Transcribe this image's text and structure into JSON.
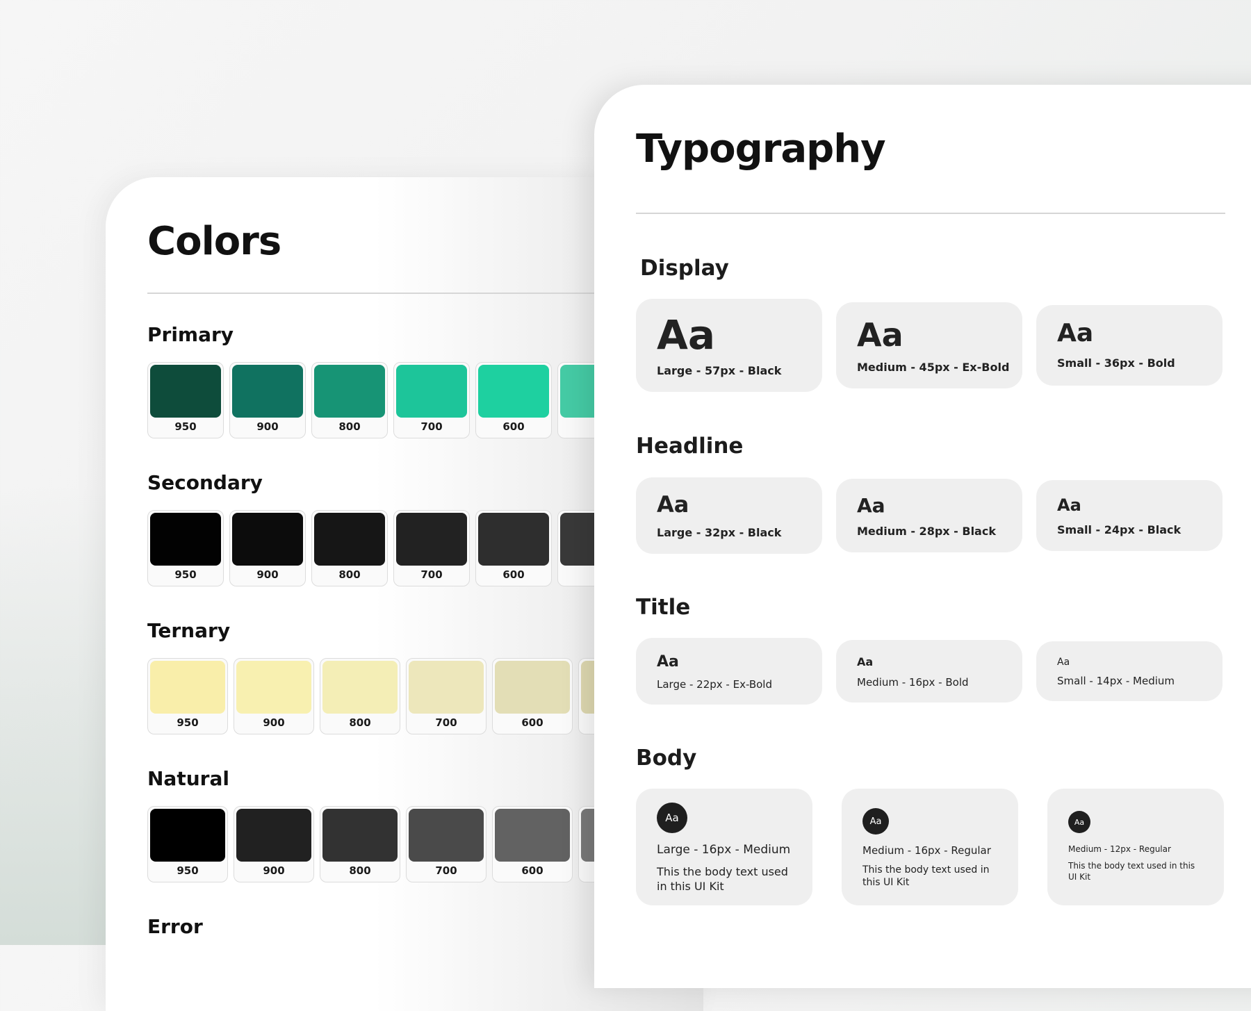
{
  "colors": {
    "title": "Colors",
    "groups": [
      {
        "name": "Primary",
        "swatches": [
          {
            "shade": "950",
            "color": "#0e4c3b"
          },
          {
            "shade": "900",
            "color": "#107260"
          },
          {
            "shade": "800",
            "color": "#179475"
          },
          {
            "shade": "700",
            "color": "#1dc59a"
          },
          {
            "shade": "600",
            "color": "#1ed0a0"
          },
          {
            "shade": "",
            "color": "#45cba5"
          }
        ]
      },
      {
        "name": "Secondary",
        "swatches": [
          {
            "shade": "950",
            "color": "#020202"
          },
          {
            "shade": "900",
            "color": "#0c0c0c"
          },
          {
            "shade": "800",
            "color": "#161616"
          },
          {
            "shade": "700",
            "color": "#222222"
          },
          {
            "shade": "600",
            "color": "#2e2e2e"
          },
          {
            "shade": "",
            "color": "#393939"
          }
        ]
      },
      {
        "name": "Ternary",
        "swatches": [
          {
            "shade": "950",
            "color": "#f9eeaa"
          },
          {
            "shade": "900",
            "color": "#f8f0b0"
          },
          {
            "shade": "800",
            "color": "#f4eeb6"
          },
          {
            "shade": "700",
            "color": "#ede7bb"
          },
          {
            "shade": "600",
            "color": "#e3deb6"
          },
          {
            "shade": "",
            "color": "#ded8b0"
          }
        ]
      },
      {
        "name": "Natural",
        "swatches": [
          {
            "shade": "950",
            "color": "#000000"
          },
          {
            "shade": "900",
            "color": "#212121"
          },
          {
            "shade": "800",
            "color": "#323232"
          },
          {
            "shade": "700",
            "color": "#4a4a4a"
          },
          {
            "shade": "600",
            "color": "#626262"
          },
          {
            "shade": "",
            "color": "#787878"
          }
        ]
      },
      {
        "name": "Error",
        "swatches": []
      }
    ]
  },
  "typography": {
    "title": "Typography",
    "sample": "Aa",
    "display": {
      "label": "Display",
      "large": "Large - 57px - Black",
      "medium": "Medium - 45px - Ex-Bold",
      "small": "Small - 36px - Bold"
    },
    "headline": {
      "label": "Headline",
      "large": "Large - 32px - Black",
      "medium": "Medium - 28px - Black",
      "small": "Small - 24px - Black"
    },
    "title_style": {
      "label": "Title",
      "large": "Large - 22px - Ex-Bold",
      "medium": "Medium - 16px - Bold",
      "small": "Small - 14px - Medium"
    },
    "body": {
      "label": "Body",
      "large": {
        "spec": "Large - 16px - Medium",
        "text": "This the body text used in this UI Kit"
      },
      "medium": {
        "spec": "Medium - 16px - Regular",
        "text": "This the body text used in this UI Kit"
      },
      "small": {
        "spec": "Medium - 12px - Regular",
        "text": "This the body text used in this UI Kit"
      }
    }
  }
}
